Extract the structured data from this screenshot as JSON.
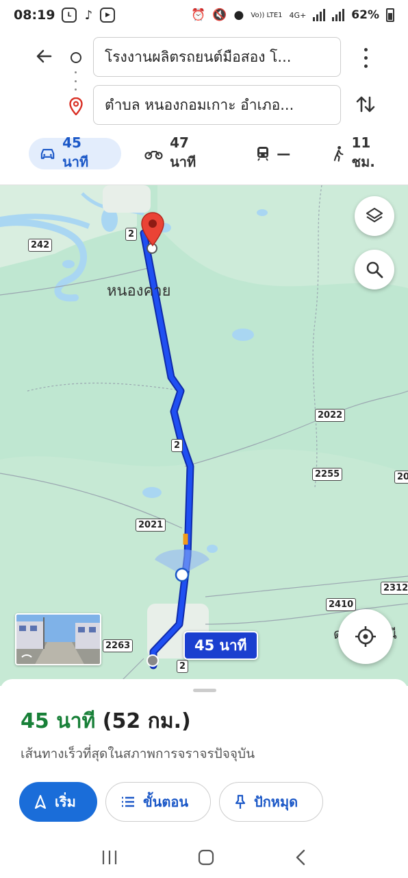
{
  "status_bar": {
    "time": "08:19",
    "app_icons": [
      "LINE",
      "TikTok",
      "Media"
    ],
    "network": "Vo)) LTE1",
    "net_type": "4G+",
    "battery": "62%"
  },
  "directions": {
    "origin": "โรงงานผลิตรถยนต์มือสอง โ...",
    "destination": "ตำบล หนองกอมเกาะ อำเภอ...",
    "modes": [
      {
        "name": "driving",
        "label": "45 นาที",
        "active": true
      },
      {
        "name": "motorcycle",
        "label": "47 นาที",
        "active": false
      },
      {
        "name": "transit",
        "label": "—",
        "active": false
      },
      {
        "name": "walking",
        "label": "11 ชม.",
        "active": false
      }
    ]
  },
  "map": {
    "place_label": "หนองคาย",
    "shields": [
      "242",
      "2",
      "2",
      "2022",
      "2255",
      "20",
      "2021",
      "2312",
      "2410",
      "2263",
      "2"
    ],
    "route_label": "45 นาที",
    "partial_label_left": "ด",
    "partial_label_right": "นี",
    "colors": {
      "route": "#1a3fd6",
      "route_outline": "#0f2aa8",
      "map_bg": "#bfe7d1",
      "water": "#a9d6f2"
    }
  },
  "sheet": {
    "duration": "45 นาที",
    "distance": "(52 กม.)",
    "subtitle": "เส้นทางเร็วที่สุดในสภาพการจราจรปัจจุบัน",
    "start_label": "เริ่ม",
    "steps_label": "ขั้นตอน",
    "pin_label": "ปักหมุด"
  }
}
